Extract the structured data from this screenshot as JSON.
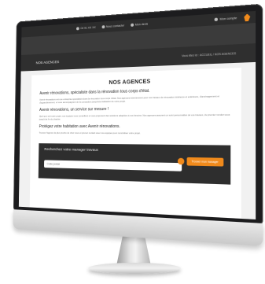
{
  "topbar": {
    "phone": "04 91 XX XX",
    "contact": "Nous contacter",
    "devis": "Mon devis",
    "account": "Mon compte"
  },
  "subheader": {
    "title": "NOS AGENCES",
    "breadcrumb": "Vous êtes ici : ACCUEIL / NOS AGENCES"
  },
  "content": {
    "title": "NOS AGENCES",
    "heading1": "Avenir rénovations, spécialiste dans la rénovation tous corps d'état.",
    "para1": "Avenir rénovations est une entreprise spécialisée dans la rénovation tous corps d'état. Nos agences interviennent pour vos travaux de rénovation intérieure et extérieure, d'aménagement et d'agrandissement, et vous accompagnent de la conception jusqu'à la réalisation de votre projet.",
    "heading2": "Avenir rénovations, un service sur mesure !",
    "para2": "Quel que soit votre projet, nos équipes vous conseillent et vous proposent des solutions adaptées à vos besoins. Nos agences assurent un suivi personnalisé de vos travaux, du premier rendez-vous jusqu'à la fin du chantier.",
    "heading3": "Protégez votre habitation avec Avenir rénovations.",
    "para3": "Trouvez l'agence la plus proche de chez vous et prenez contact avec nos équipes pour concrétiser votre projet.",
    "search_title": "Recherchez votre manager travaux",
    "search_placeholder": "Code postal",
    "search_button": "Trouver mon manager"
  },
  "colors": {
    "accent": "#f08a1c",
    "dark": "#2c2c2c"
  }
}
